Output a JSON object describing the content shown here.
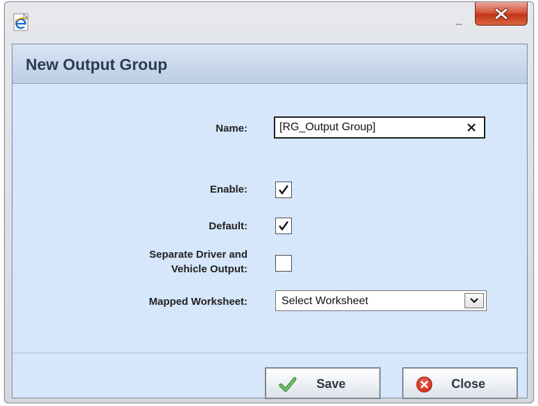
{
  "window": {
    "title_overflow": "...",
    "close_icon": "close-x-icon",
    "app_icon": "internet-explorer-icon"
  },
  "dialog": {
    "title": "New Output Group"
  },
  "form": {
    "name_label": "Name:",
    "name_value": "[RG_Output Group]",
    "enable_label": "Enable:",
    "enable_checked": true,
    "default_label": "Default:",
    "default_checked": true,
    "separate_label_line1": "Separate Driver and",
    "separate_label_line2": "Vehicle Output:",
    "separate_checked": false,
    "worksheet_label": "Mapped Worksheet:",
    "worksheet_selected": "Select Worksheet"
  },
  "buttons": {
    "save_label": "Save",
    "close_label": "Close"
  },
  "colors": {
    "body_bg": "#d6e6fb",
    "header_title": "#2a3d55",
    "close_button": "#c23618",
    "save_check": "#3aa23a",
    "close_circle": "#d83b2a"
  }
}
